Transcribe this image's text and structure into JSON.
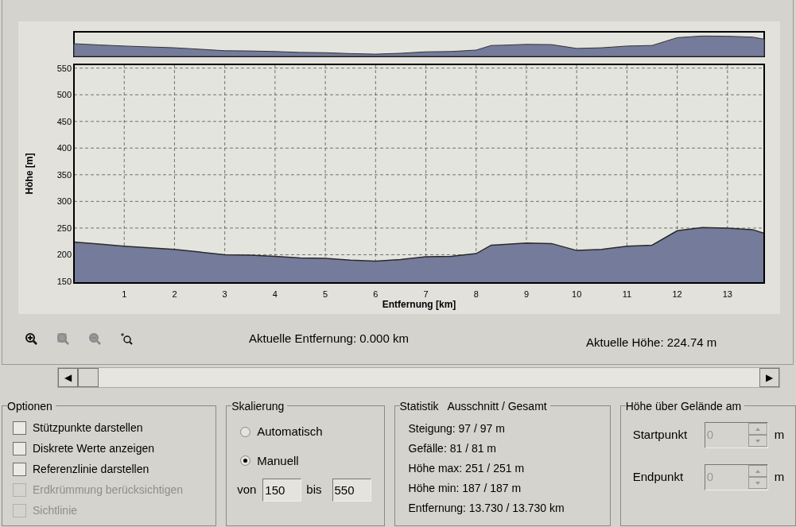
{
  "profile_chart": {
    "chart_data": {
      "type": "area",
      "xlabel": "Entfernung [km]",
      "ylabel": "Höhe [m]",
      "x": [
        0,
        0.5,
        1,
        1.5,
        2,
        2.5,
        3,
        3.5,
        4,
        4.5,
        5,
        5.5,
        6,
        6.5,
        7,
        7.5,
        8,
        8.3,
        8.5,
        9,
        9.5,
        10,
        10.5,
        11,
        11.5,
        12,
        12.5,
        13,
        13.5,
        13.73
      ],
      "series": [
        {
          "color": "#757b9b",
          "values": [
            224,
            220,
            216,
            213,
            210,
            205,
            200,
            199,
            197,
            194,
            193,
            190,
            188,
            191,
            196,
            197,
            202,
            218,
            219,
            222,
            221,
            208,
            210,
            216,
            218,
            245,
            251,
            250,
            247,
            240
          ]
        }
      ],
      "xlim": [
        0,
        13.73
      ],
      "ylim": [
        147,
        557
      ],
      "grid": true,
      "xticks": [
        1,
        2,
        3,
        4,
        5,
        6,
        7,
        8,
        9,
        10,
        11,
        12,
        13
      ],
      "yticks": [
        150,
        200,
        250,
        300,
        350,
        400,
        450,
        500,
        550
      ]
    }
  },
  "toolbar": [
    {
      "kind": "zoom-in",
      "disabled": false
    },
    {
      "kind": "zoom-area",
      "disabled": true
    },
    {
      "kind": "zoom-out",
      "disabled": true
    },
    {
      "kind": "zoom-reset",
      "disabled": false
    }
  ],
  "current_distance": "Aktuelle Entfernung: 0.000 km",
  "current_height": "Aktuelle Höhe: 224.74 m",
  "scrollbar": {
    "left": "◀",
    "right": "▶"
  },
  "options": {
    "title": "Optionen",
    "items": [
      {
        "label": "Stützpunkte darstellen",
        "checked": false,
        "disabled": false
      },
      {
        "label": "Diskrete Werte anzeigen",
        "checked": false,
        "disabled": false
      },
      {
        "label": "Referenzlinie darstellen",
        "checked": false,
        "disabled": false
      },
      {
        "label": "Erdkrümmung berücksichtigen",
        "checked": false,
        "disabled": true
      },
      {
        "label": "Sichtlinie",
        "checked": false,
        "disabled": true
      }
    ]
  },
  "scaling": {
    "title": "Skalierung",
    "modes": [
      {
        "label": "Automatisch",
        "selected": false
      },
      {
        "label": "Manuell",
        "selected": true
      }
    ],
    "from_label": "von",
    "from_value": "150",
    "to_label": "bis",
    "to_value": "550"
  },
  "statistics": {
    "title": "Statistik   Ausschnitt / Gesamt",
    "lines": [
      "Steigung: 97 / 97 m",
      "Gefälle: 81 / 81 m",
      "Höhe max: 251 / 251 m",
      "Höhe min: 187 / 187 m",
      "Entfernung: 13.730 / 13.730 km"
    ]
  },
  "height_above_ground": {
    "title": "Höhe über Gelände am",
    "fields": [
      {
        "label": "Startpunkt",
        "value": "0",
        "unit": "m",
        "disabled": true
      },
      {
        "label": "Endpunkt",
        "value": "0",
        "unit": "m",
        "disabled": true
      }
    ]
  }
}
